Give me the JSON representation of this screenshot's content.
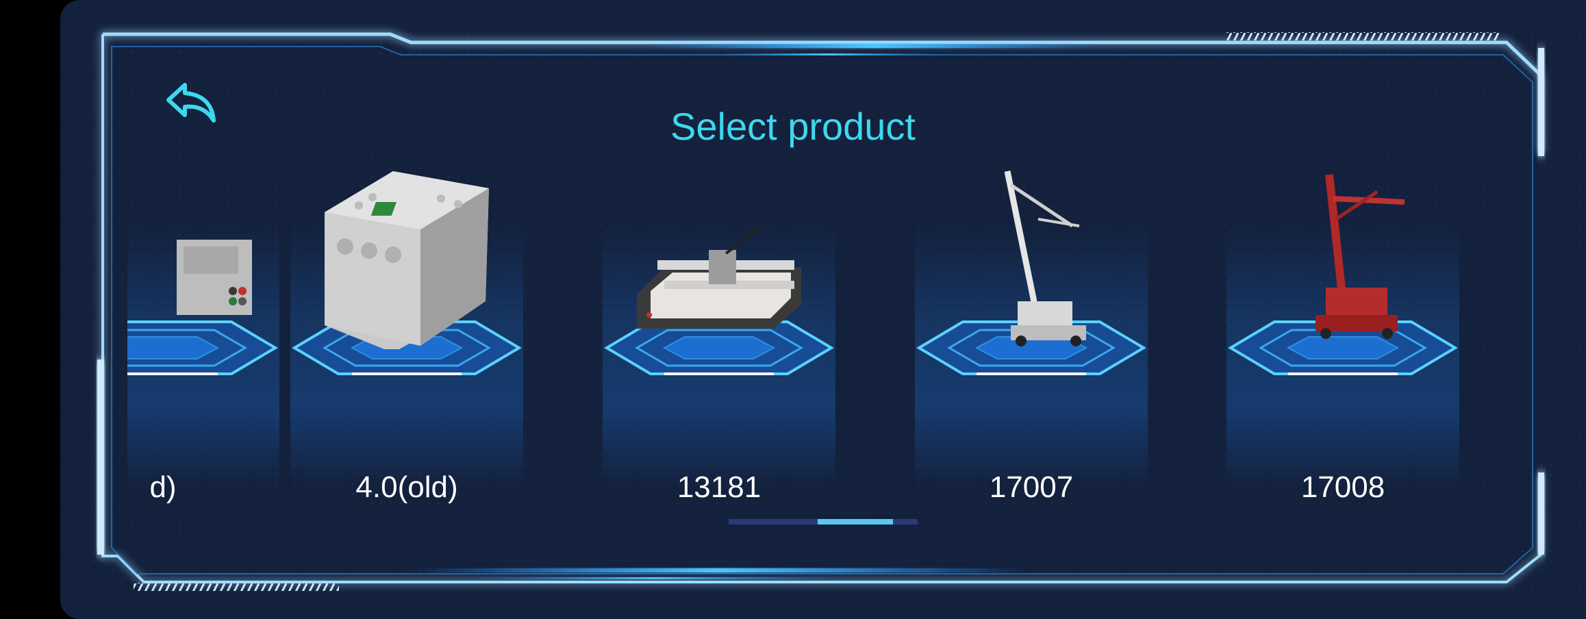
{
  "header": {
    "title": "Select product"
  },
  "icons": {
    "back": "back-arrow-icon"
  },
  "products": [
    {
      "label": "d)"
    },
    {
      "label": "4.0(old)"
    },
    {
      "label": "13181"
    },
    {
      "label": "17007"
    },
    {
      "label": "17008"
    }
  ],
  "colors": {
    "background": "#13213d",
    "accent": "#3ed8ee",
    "frame": "#9fdcff",
    "scroll_thumb": "#5ac8f0",
    "scroll_track": "#2a3a78"
  }
}
